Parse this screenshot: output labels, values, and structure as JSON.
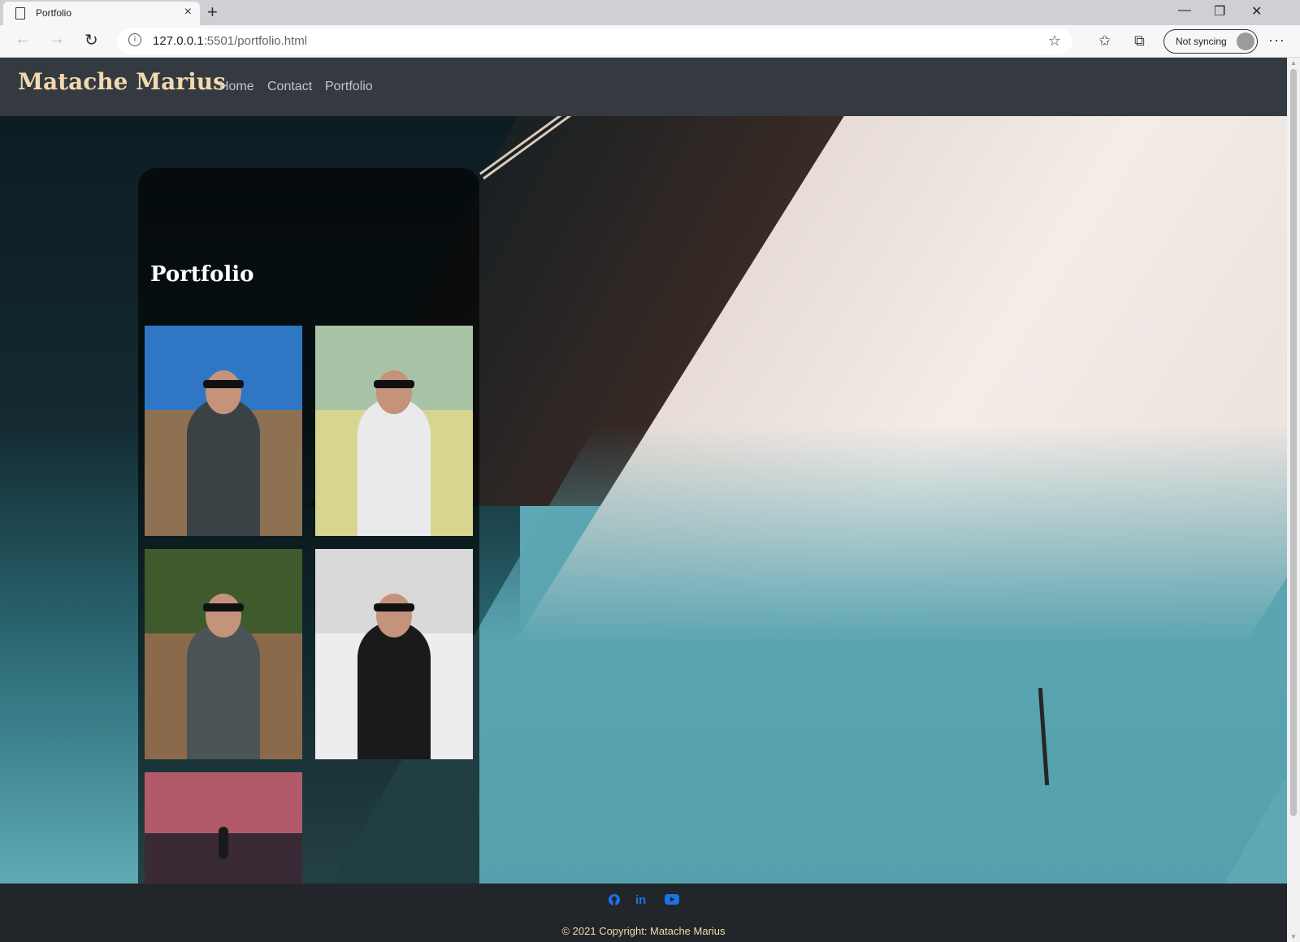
{
  "browser": {
    "tab_title": "Portfolio",
    "new_tab_symbol": "+",
    "close_tab_symbol": "×",
    "url_host": "127.0.0.1",
    "url_rest": ":5501/portfolio.html",
    "sync_label": "Not syncing",
    "window_controls": {
      "minimize": "—",
      "restore": "❐",
      "close": "✕"
    }
  },
  "navbar": {
    "brand": "Matache Marius",
    "links": [
      "Home",
      "Contact",
      "Portfolio"
    ]
  },
  "portfolio": {
    "title": "Portfolio",
    "photos": [
      {
        "name": "canyon-selfie",
        "sky": "#2f77c4",
        "ground": "#8e7053",
        "shirt": "#3a4246"
      },
      {
        "name": "lake-hoodie",
        "sky": "#a9c3a6",
        "ground": "#d7d58f",
        "shirt": "#e9eaec"
      },
      {
        "name": "forest-bench",
        "sky": "#3f5a2c",
        "ground": "#8b6a4c",
        "shirt": "#4b5456"
      },
      {
        "name": "snow-mountain-bw",
        "sky": "#d9d9d9",
        "ground": "#ededed",
        "shirt": "#1a1a1a"
      },
      {
        "name": "sunset-lake",
        "sky": "#b25a69",
        "ground": "#3a2a36",
        "shirt": "#1a1a1a"
      }
    ]
  },
  "footer": {
    "icons": [
      "github-icon",
      "linkedin-icon",
      "youtube-icon"
    ],
    "linkedin_text": "in",
    "copyright": "© 2021 Copyright: Matache Marius"
  },
  "colors": {
    "navbar_bg": "#343a40",
    "brand": "#f3d9ad",
    "footer_bg": "#22262a",
    "social": "#1a73e8"
  }
}
